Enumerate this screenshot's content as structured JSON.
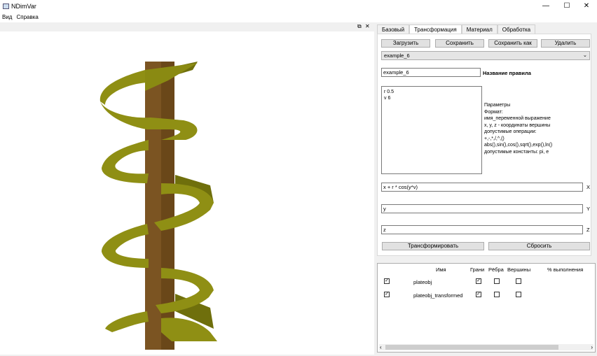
{
  "window": {
    "title": "NDimVar",
    "minimize": "—",
    "maximize": "☐",
    "close": "✕"
  },
  "menu": [
    "Вид",
    "Справка"
  ],
  "dock": {
    "float_icon": "⧉",
    "close_icon": "✕"
  },
  "colors": {
    "plate": "#7b5422",
    "ribbon": "#8f8f14",
    "ribbon_dark": "#6f6f0c"
  },
  "tabs": [
    "Базовый",
    "Трансформация",
    "Материал",
    "Обработка"
  ],
  "active_tab": "Трансформация",
  "buttons": {
    "load": "Загрузить",
    "save": "Сохранить",
    "save_as": "Сохранить как",
    "delete": "Удалить",
    "transform": "Трансформировать",
    "reset": "Сбросить"
  },
  "rule_select": "example_6",
  "rule_name": {
    "value": "example_6",
    "label": "Название правила"
  },
  "params": {
    "lines": [
      "r 0.5",
      "v 6"
    ]
  },
  "help": [
    "Параметры",
    "Формат:",
    "имя_переменной выражение",
    "x, y, z - координаты вершины",
    "допустимые операции:",
    "+,-,*,/,^,()",
    "abs(),sin(),cos(),sqrt(),exp(),ln()",
    "допустимые константы: pi, e"
  ],
  "expr": {
    "x": "x + r * cos(y*v)",
    "y": "y",
    "z": "z",
    "x_label": "X",
    "y_label": "Y",
    "z_label": "Z"
  },
  "objects": {
    "headers": [
      "Имя",
      "Грани",
      "Рёбра",
      "Вершины",
      "% выполнения"
    ],
    "rows": [
      {
        "visible": true,
        "name": "plateobj",
        "faces": true,
        "edges": false,
        "vertices": false
      },
      {
        "visible": true,
        "name": "plateobj_transformed",
        "faces": true,
        "edges": false,
        "vertices": false
      }
    ]
  },
  "scroll": {
    "left": "‹",
    "right": "›"
  }
}
